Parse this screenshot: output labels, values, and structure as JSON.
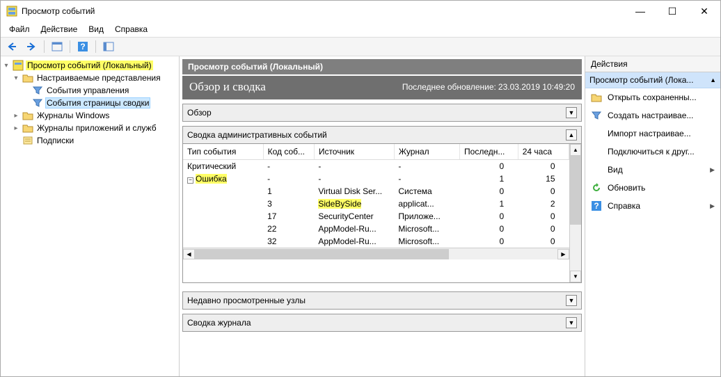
{
  "window": {
    "title": "Просмотр событий"
  },
  "menu": {
    "file": "Файл",
    "action": "Действие",
    "view": "Вид",
    "help": "Справка"
  },
  "tree": {
    "root": "Просмотр событий (Локальный)",
    "custom_views": "Настраиваемые представления",
    "mgmt_events": "События управления",
    "summary_events": "События страницы сводки",
    "win_logs": "Журналы Windows",
    "app_services": "Журналы приложений и служб",
    "subscriptions": "Подписки"
  },
  "main": {
    "title": "Просмотр событий (Локальный)",
    "overview_heading": "Обзор и сводка",
    "last_update_label": "Последнее обновление:",
    "last_update_value": "23.03.2019 10:49:20",
    "sections": {
      "overview": "Обзор",
      "admin_summary": "Сводка административных событий",
      "recent_nodes": "Недавно просмотренные узлы",
      "log_summary": "Сводка журнала"
    },
    "table": {
      "headers": {
        "type": "Тип события",
        "code": "Код соб...",
        "source": "Источник",
        "log": "Журнал",
        "last": "Последн...",
        "h24": "24 часа"
      },
      "rows": [
        {
          "type": "Критический",
          "code": "-",
          "source": "-",
          "log": "-",
          "last": "0",
          "h24": "0"
        },
        {
          "type": "Ошибка",
          "code": "-",
          "source": "-",
          "log": "-",
          "last": "1",
          "h24": "15",
          "hl_type": true,
          "expand": true
        },
        {
          "type": "",
          "code": "1",
          "source": "Virtual Disk Ser...",
          "log": "Система",
          "last": "0",
          "h24": "0"
        },
        {
          "type": "",
          "code": "3",
          "source": "SideBySide",
          "log": "applicat...",
          "last": "1",
          "h24": "2",
          "hl_source": true
        },
        {
          "type": "",
          "code": "17",
          "source": "SecurityCenter",
          "log": "Приложе...",
          "last": "0",
          "h24": "0"
        },
        {
          "type": "",
          "code": "22",
          "source": "AppModel-Ru...",
          "log": "Microsoft...",
          "last": "0",
          "h24": "0"
        },
        {
          "type": "",
          "code": "32",
          "source": "AppModel-Ru...",
          "log": "Microsoft...",
          "last": "0",
          "h24": "0"
        }
      ]
    }
  },
  "actions": {
    "title": "Действия",
    "header": "Просмотр событий (Лока...",
    "items": {
      "open_saved": "Открыть сохраненны...",
      "create_custom": "Создать настраивае...",
      "import_custom": "Импорт настраивае...",
      "connect": "Подключиться к друг...",
      "view": "Вид",
      "refresh": "Обновить",
      "help": "Справка"
    }
  }
}
